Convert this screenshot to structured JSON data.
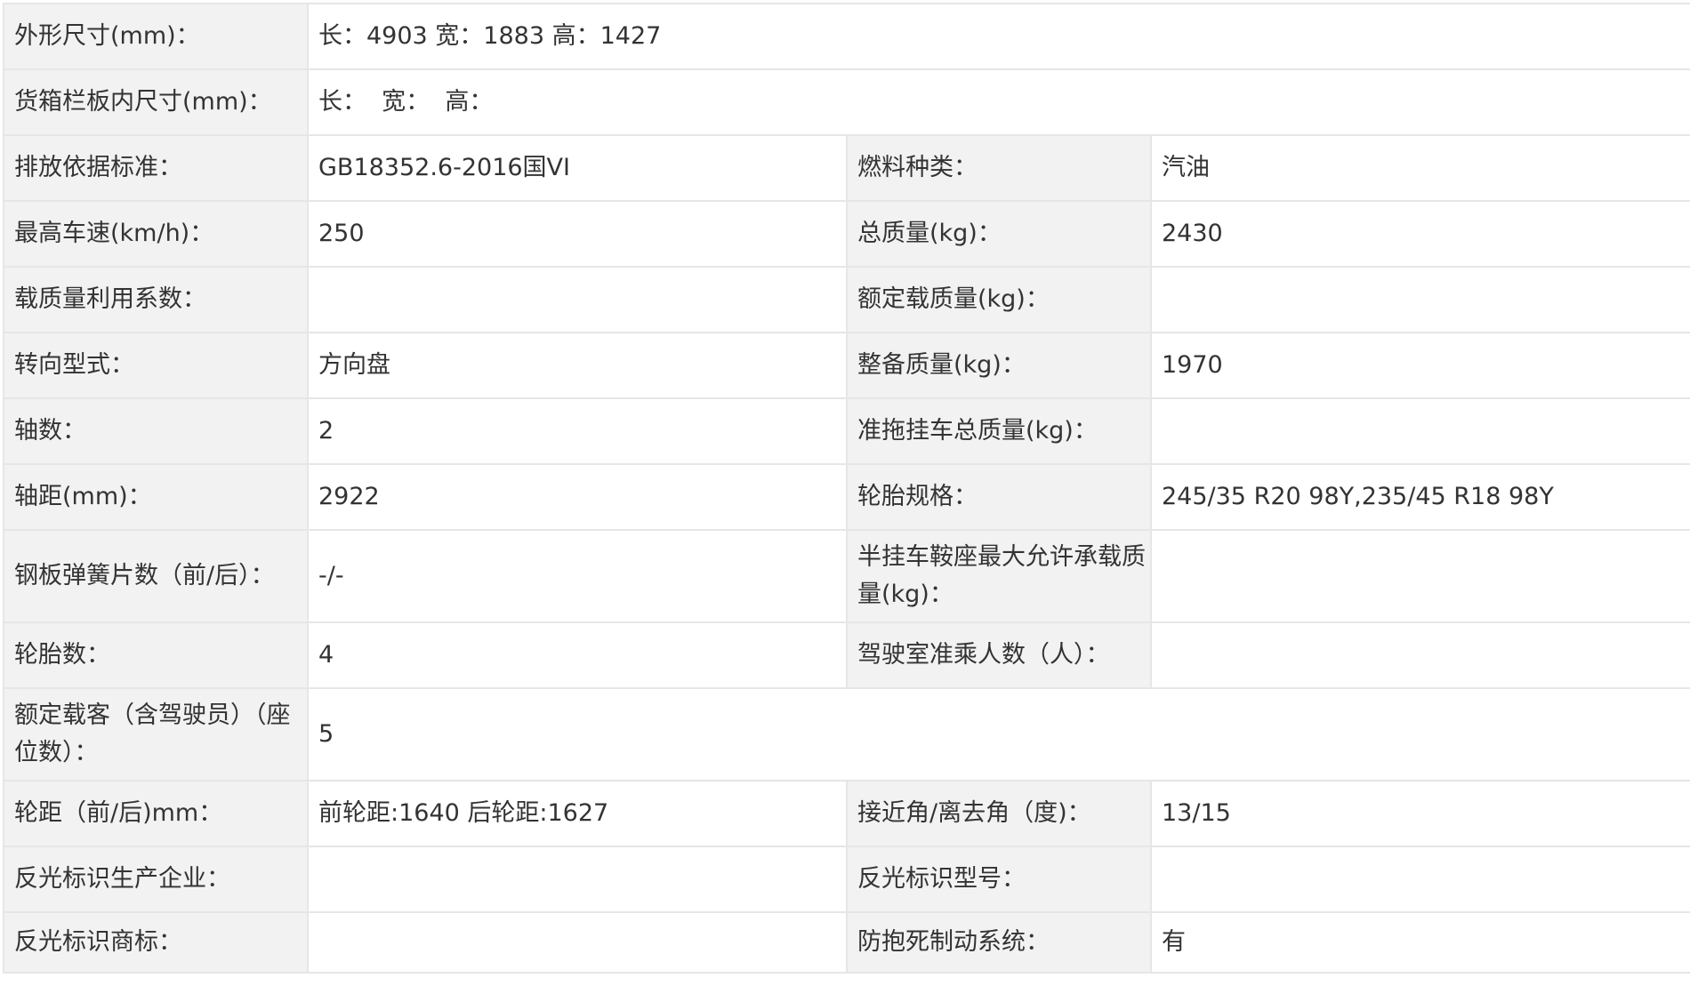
{
  "rows": [
    {
      "cells": [
        {
          "label": "外形尺寸(mm)："
        },
        {
          "value": "长：4903 宽：1883 高：1427"
        }
      ]
    },
    {
      "cells": [
        {
          "label": "货箱栏板内尺寸(mm)："
        },
        {
          "value": "长：  宽：  高："
        }
      ]
    },
    {
      "cells": [
        {
          "label": "排放依据标准："
        },
        {
          "value": "GB18352.6-2016国VI"
        },
        {
          "label": "燃料种类："
        },
        {
          "value": "汽油"
        }
      ]
    },
    {
      "cells": [
        {
          "label": "最高车速(km/h)："
        },
        {
          "value": "250"
        },
        {
          "label": "总质量(kg)："
        },
        {
          "value": "2430"
        }
      ]
    },
    {
      "cells": [
        {
          "label": "载质量利用系数："
        },
        {
          "value": ""
        },
        {
          "label": "额定载质量(kg)："
        },
        {
          "value": ""
        }
      ]
    },
    {
      "cells": [
        {
          "label": "转向型式："
        },
        {
          "value": "方向盘"
        },
        {
          "label": "整备质量(kg)："
        },
        {
          "value": "1970"
        }
      ]
    },
    {
      "cells": [
        {
          "label": "轴数："
        },
        {
          "value": "2"
        },
        {
          "label": "准拖挂车总质量(kg)："
        },
        {
          "value": ""
        }
      ]
    },
    {
      "cells": [
        {
          "label": "轴距(mm)："
        },
        {
          "value": "2922"
        },
        {
          "label": "轮胎规格："
        },
        {
          "value": "245/35 R20 98Y,235/45 R18 98Y"
        }
      ]
    },
    {
      "cells": [
        {
          "label": "钢板弹簧片数（前/后）："
        },
        {
          "value": "-/-"
        },
        {
          "label": "半挂车鞍座最大允许承载质量(kg)："
        },
        {
          "value": ""
        }
      ]
    },
    {
      "cells": [
        {
          "label": "轮胎数："
        },
        {
          "value": "4"
        },
        {
          "label": "驾驶室准乘人数（人）："
        },
        {
          "value": ""
        }
      ]
    },
    {
      "cells": [
        {
          "label": "额定载客（含驾驶员）（座位数）："
        },
        {
          "value": "5"
        }
      ]
    },
    {
      "cells": [
        {
          "label": "轮距（前/后)mm："
        },
        {
          "value": "前轮距:1640 后轮距:1627"
        },
        {
          "label": "接近角/离去角（度)："
        },
        {
          "value": "13/15"
        }
      ]
    },
    {
      "cells": [
        {
          "label": "反光标识生产企业："
        },
        {
          "value": ""
        },
        {
          "label": "反光标识型号："
        },
        {
          "value": ""
        }
      ]
    },
    {
      "cells": [
        {
          "label": "反光标识商标："
        },
        {
          "value": ""
        },
        {
          "label": "防抱死制动系统："
        },
        {
          "value": "有"
        }
      ]
    }
  ]
}
